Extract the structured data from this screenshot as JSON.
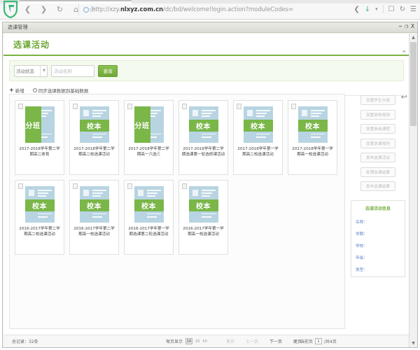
{
  "browser": {
    "url_prefix": "http://xzy.",
    "url_domain": "nlxyz.com.cn",
    "url_suffix": "/dc/bd/welcome!login.action?moduleCodes=",
    "back_icon": "back-chevron",
    "forward_icon": "forward-chevron",
    "reload_icon": "reload",
    "home_icon": "home",
    "star_icon": "bookmark-star",
    "share_icon": "share",
    "menu_icon": "hamburger-menu"
  },
  "window": {
    "title": "选课管理",
    "minimize": "−",
    "maximize": "❐",
    "close": "X"
  },
  "page": {
    "title": "选课活动"
  },
  "search": {
    "status_label": "活动状态",
    "name_placeholder": "活动名称",
    "query_button": "查询"
  },
  "toolbar": {
    "add_label": "新增",
    "sync_label": "同步选课数据到基础数据"
  },
  "cards": [
    {
      "badge": "分班",
      "style": "split",
      "label": "2017-2018学年第二学期高二体育"
    },
    {
      "badge": "校本",
      "style": "band",
      "label": "2017-2018学年第二学期高二校选课活动"
    },
    {
      "badge": "分班",
      "style": "split",
      "label": "2017-2018学年第二学期高一六选三"
    },
    {
      "badge": "校本",
      "style": "band",
      "label": "2017-2018学年第二学期选课第一轮选修课活动"
    },
    {
      "badge": "校本",
      "style": "band",
      "label": "2017-2018学年第一学期高二校选课活动"
    },
    {
      "badge": "校本",
      "style": "band",
      "label": "2017-2018学年第一学期高一校选课活动"
    },
    {
      "badge": "校本",
      "style": "band",
      "label": "2016-2017学年第二学期高二校选课活动"
    },
    {
      "badge": "校本",
      "style": "band",
      "label": "2016-2017学年第二学期高一校选课活动"
    },
    {
      "badge": "校本",
      "style": "band",
      "label": "2016-2017学年第一学期选课第二轮选课活动"
    },
    {
      "badge": "校本",
      "style": "band",
      "label": "2016-2017学年第一学期高一校选课活动"
    }
  ],
  "side_buttons": [
    "设置学生分组",
    "设置审核规则",
    "设置参选课程",
    "设置选课规则",
    "发布选课活动",
    "处理选课结果",
    "发布选课结果"
  ],
  "info_panel": {
    "title": "选课活动信息",
    "rows": [
      "名称：",
      "学期：",
      "学校：",
      "年级：",
      "类型："
    ]
  },
  "footer": {
    "total": "总记录：32条",
    "page_size_label": "每页显示",
    "size_10": "10",
    "size_20": "20",
    "size_50": "50",
    "first": "首页",
    "prev": "上一页",
    "next": "下一页",
    "last": "尾页",
    "current_label": "当前页",
    "current_value": "1",
    "total_pages": "/共4页"
  },
  "colors": {
    "accent_green": "#7cb342",
    "badge_green": "#7ab648",
    "doc_blue": "#b8d4e2",
    "info_blue": "#5b7fc7"
  }
}
